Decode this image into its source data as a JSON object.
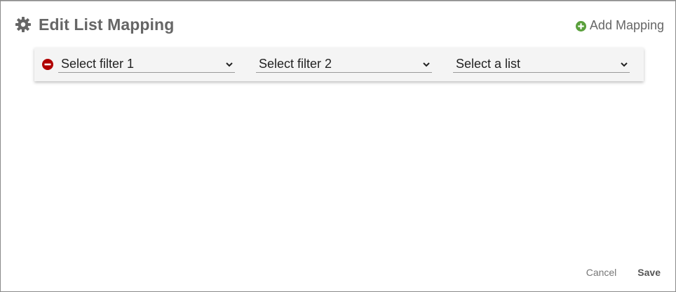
{
  "dialog": {
    "title": "Edit List Mapping",
    "title_icon": "gear-icon",
    "add_mapping_label": "Add Mapping",
    "add_mapping_icon": "plus-circle-icon"
  },
  "mappings": [
    {
      "remove_icon": "minus-circle-icon",
      "filter1": "Select filter 1",
      "filter2": "Select filter 2",
      "list": "Select a list"
    }
  ],
  "footer": {
    "cancel_label": "Cancel",
    "save_label": "Save"
  },
  "colors": {
    "add_icon": "#5aa03c",
    "remove_icon": "#b00000",
    "title_text": "#666666",
    "row_bg": "#f4f4f4"
  }
}
